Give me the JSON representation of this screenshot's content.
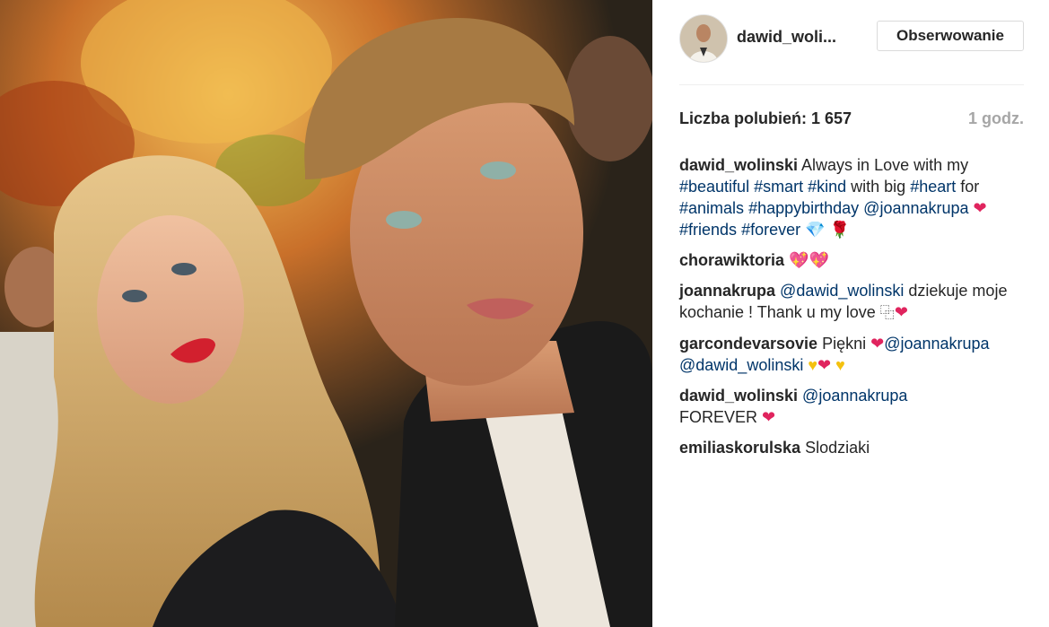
{
  "post": {
    "username": "dawid_woli...",
    "follow_label": "Obserwowanie",
    "likes": "Liczba polubień: 1 657",
    "time": "1 godz."
  },
  "caption": {
    "user": "dawid_wolinski",
    "t1": " Always in Love with my ",
    "h1": "#beautiful",
    "h2": "#smart",
    "h3": "#kind",
    "t2": " with big ",
    "h4": "#heart",
    "t3": " for ",
    "h5": "#animals",
    "h6": "#happybirthday",
    "m1": "@joannakrupa",
    "h7": "#friends",
    "h8": "#forever"
  },
  "comments": {
    "c1_user": "chorawiktoria",
    "c2_user": "joannakrupa",
    "c2_mention": "@dawid_wolinski",
    "c2_text": " dziekuje moje kochanie ! Thank u my love ",
    "c3_user": "garcondevarsovie",
    "c3_text": " Piękni ",
    "c3_mention1": "@joannakrupa",
    "c3_mention2": "@dawid_wolinski",
    "c4_user": "dawid_wolinski",
    "c4_mention": "@joannakrupa",
    "c4_text": " FOREVER ",
    "c5_user": "emiliaskorulska",
    "c5_text": " Slodziaki"
  },
  "emoji": {
    "heart": "❤",
    "yellow_heart": "♥",
    "pink_hearts": "💖💖",
    "gem": "💎",
    "rose": "🌹",
    "box": "⿻"
  },
  "colors": {
    "hashtag": "#003569",
    "username": "#262626",
    "muted": "#a6a6a6",
    "heart_red": "#e0245e"
  }
}
